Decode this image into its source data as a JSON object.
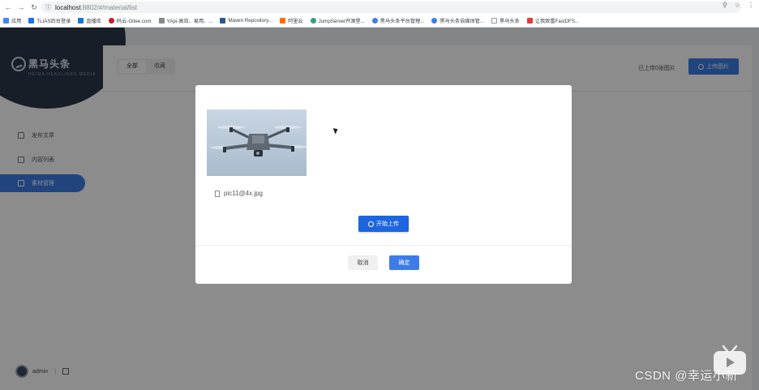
{
  "browser": {
    "url_host": "localhost",
    "url_path": ":8802/#/material/list",
    "bookmarks": [
      {
        "label": "应用",
        "color": "#4285f4"
      },
      {
        "label": "TLIAS后台登录",
        "color": "#1a73e8"
      },
      {
        "label": "直播库",
        "color": "#1976d2"
      },
      {
        "label": "码云-Gitee.com",
        "color": "#c71d23"
      },
      {
        "label": "YApi-高效、易用、...",
        "color": "#888888"
      },
      {
        "label": "Maven Repository...",
        "color": "#2b5797"
      },
      {
        "label": "阿里云",
        "color": "#ff6a00"
      },
      {
        "label": "JumpServer开源堡...",
        "color": "#2e9f7f"
      },
      {
        "label": "黑马头条平台管理...",
        "color": "#3d7ce8"
      },
      {
        "label": "黑马头条自媒体管...",
        "color": "#3d7ce8"
      },
      {
        "label": "黑马头条",
        "color": "#999999"
      },
      {
        "label": "让我致富FastDFS...",
        "color": "#e53935"
      }
    ]
  },
  "sidebar": {
    "logo_title": "黑马头条",
    "logo_sub": "HEIMA HEADLINES MEDIA",
    "items": [
      {
        "label": "发布文章",
        "icon": "edit-icon"
      },
      {
        "label": "内容列表",
        "icon": "list-icon"
      },
      {
        "label": "素材管理",
        "icon": "image-icon"
      }
    ],
    "user": "admin",
    "divider": "|"
  },
  "main": {
    "tabs": [
      "全部",
      "收藏"
    ],
    "upload_count": "已上传0张图片",
    "upload_button": "上传图片"
  },
  "modal": {
    "file_name": "pic11@4x.jpg",
    "start_upload": "开始上传",
    "cancel": "取消",
    "confirm": "确定"
  },
  "watermark": "CSDN @幸运小新",
  "colors": {
    "primary": "#3d7ce8",
    "sidebar_dark": "#2b3847",
    "overlay": "rgba(0,0,0,0.45)"
  }
}
